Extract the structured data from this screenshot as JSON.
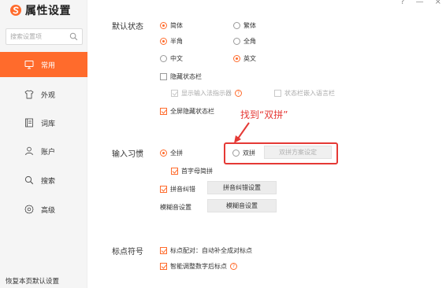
{
  "app": {
    "title": "属性设置",
    "brand_color": "#ff6b2c",
    "logo_icon": "sogou-logo-icon"
  },
  "window_controls": {
    "help": "?",
    "minimize": "—",
    "close": "×"
  },
  "search": {
    "placeholder": "搜索设置项",
    "icon": "search-icon"
  },
  "sidebar": {
    "items": [
      {
        "label": "常用",
        "icon": "monitor-icon",
        "active": true
      },
      {
        "label": "外观",
        "icon": "shirt-icon",
        "active": false
      },
      {
        "label": "词库",
        "icon": "book-icon",
        "active": false
      },
      {
        "label": "账户",
        "icon": "user-icon",
        "active": false
      },
      {
        "label": "搜索",
        "icon": "search-icon",
        "active": false
      },
      {
        "label": "高级",
        "icon": "gear-icon",
        "active": false
      }
    ],
    "reset": "恢复本页默认设置"
  },
  "default_state": {
    "label": "默认状态",
    "simplified": {
      "label": "简体",
      "selected": true
    },
    "traditional": {
      "label": "繁体",
      "selected": false
    },
    "half_width": {
      "label": "半角",
      "selected": true
    },
    "full_width": {
      "label": "全角",
      "selected": false
    },
    "chinese": {
      "label": "中文",
      "selected": false
    },
    "english": {
      "label": "英文",
      "selected": true
    },
    "hide_status_bar": {
      "label": "隐藏状态栏",
      "checked": false
    },
    "show_indicator": {
      "label": "显示输入法指示器",
      "checked": true,
      "disabled": true
    },
    "embed_status_bar": {
      "label": "状态栏嵌入语言栏",
      "checked": false,
      "disabled": true
    },
    "fullscreen_hide": {
      "label": "全屏隐藏状态栏",
      "checked": true
    }
  },
  "annotation": {
    "text": "找到“双拼”",
    "color": "#e53935"
  },
  "input_habit": {
    "label": "输入习惯",
    "full_pinyin": {
      "label": "全拼",
      "selected": true
    },
    "initial_shorthand": {
      "label": "首字母简拼",
      "checked": true
    },
    "double_pinyin": {
      "label": "双拼",
      "selected": false
    },
    "double_pinyin_button": "双拼方案设定",
    "pinyin_correction": {
      "label": "拼音纠错",
      "checked": true
    },
    "pinyin_correction_button": "拼音纠错设置",
    "fuzzy_label": "模糊音设置",
    "fuzzy_button": "模糊音设置"
  },
  "punctuation": {
    "label": "标点符号",
    "auto_pair": {
      "label": "标点配对：自动补全成对标点",
      "checked": true
    },
    "smart_after_digit": {
      "label": "智能调整数字后标点",
      "checked": true
    }
  }
}
